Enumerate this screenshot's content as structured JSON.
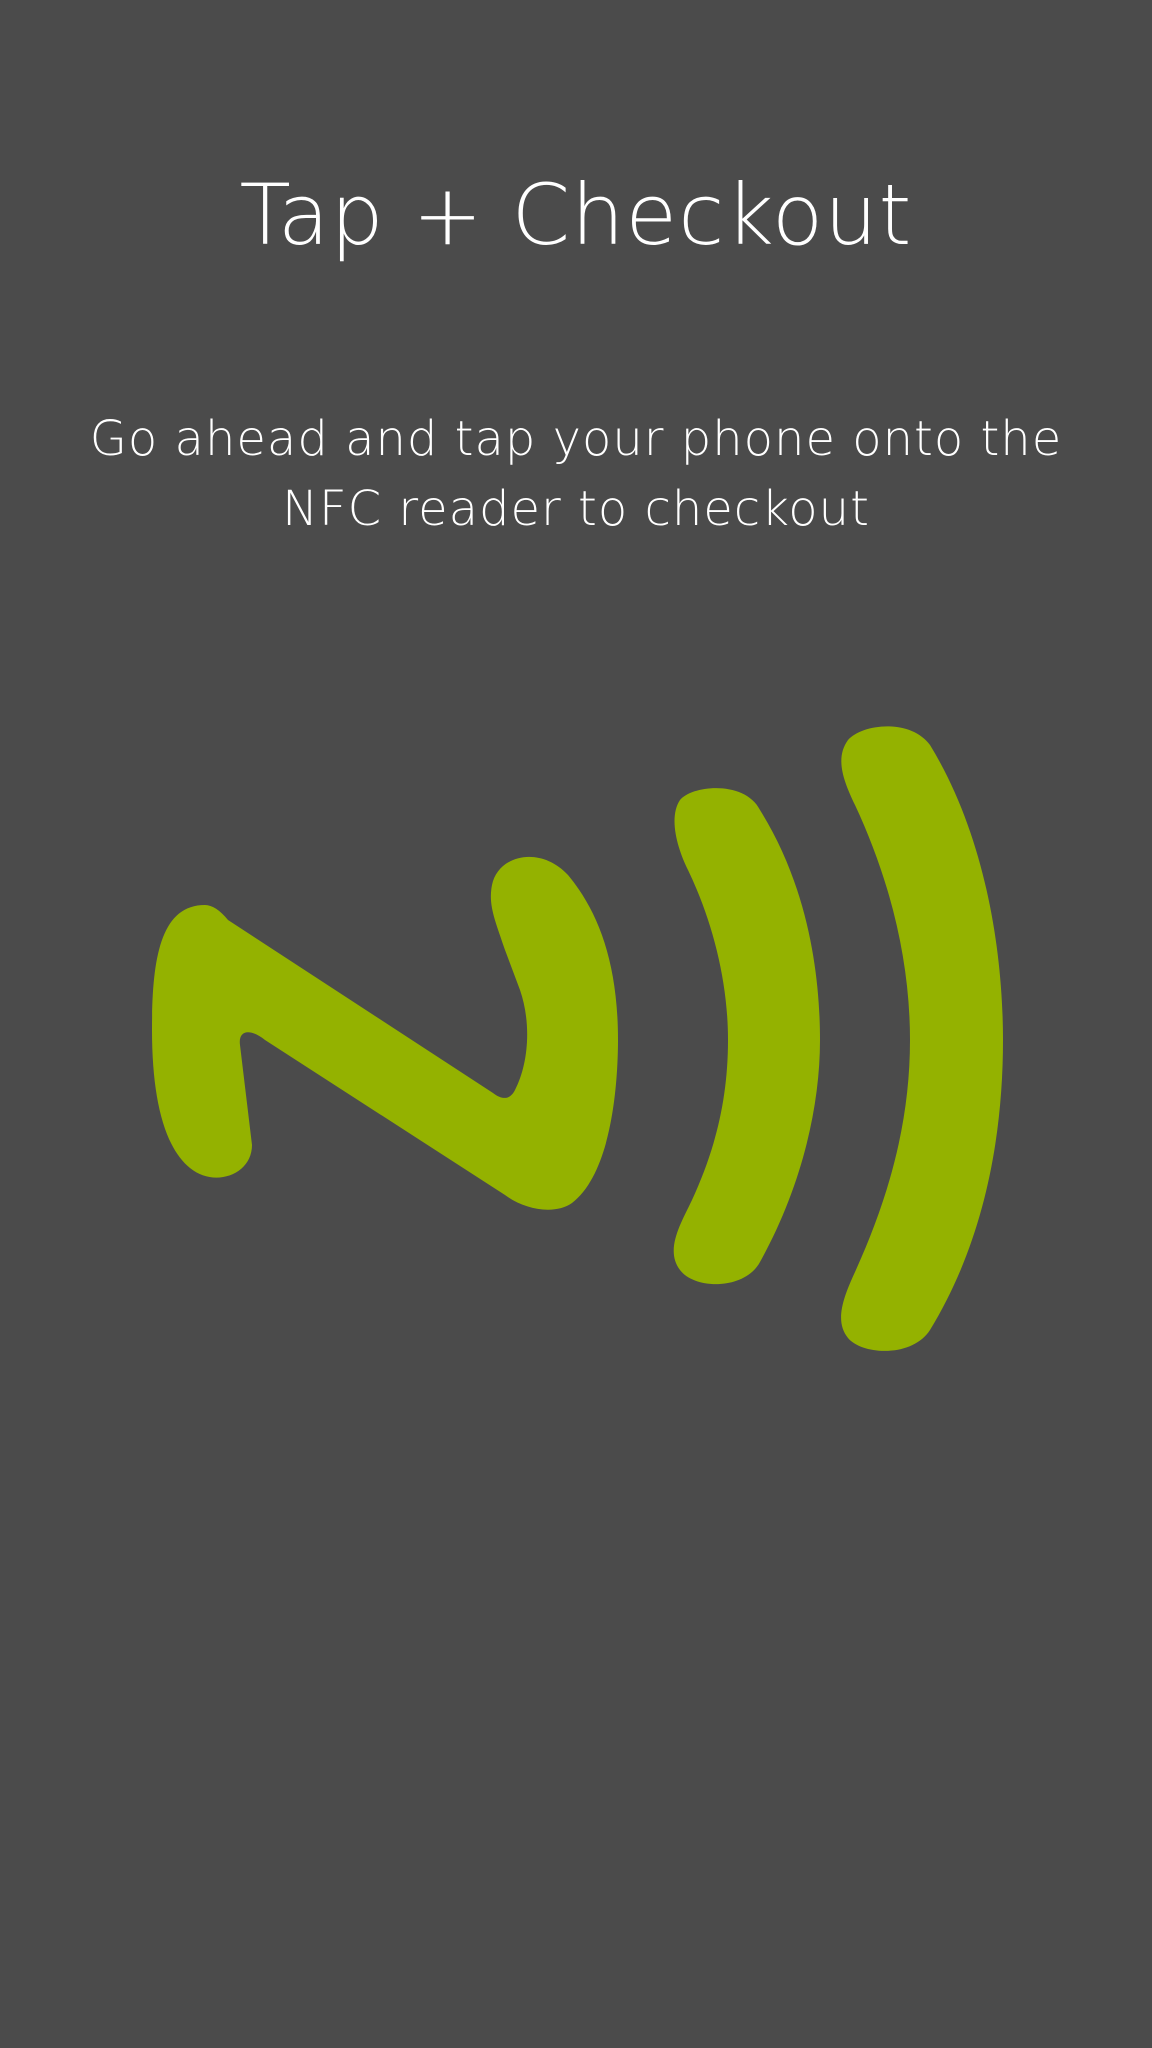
{
  "screen": {
    "title": "Tap + Checkout",
    "instruction": "Go ahead and tap your phone onto the NFC reader to checkout"
  },
  "icon": {
    "name": "nfc-icon",
    "color": "#94b200"
  },
  "colors": {
    "background": "#4b4b4b",
    "text": "#ffffff",
    "accent": "#94b200"
  }
}
